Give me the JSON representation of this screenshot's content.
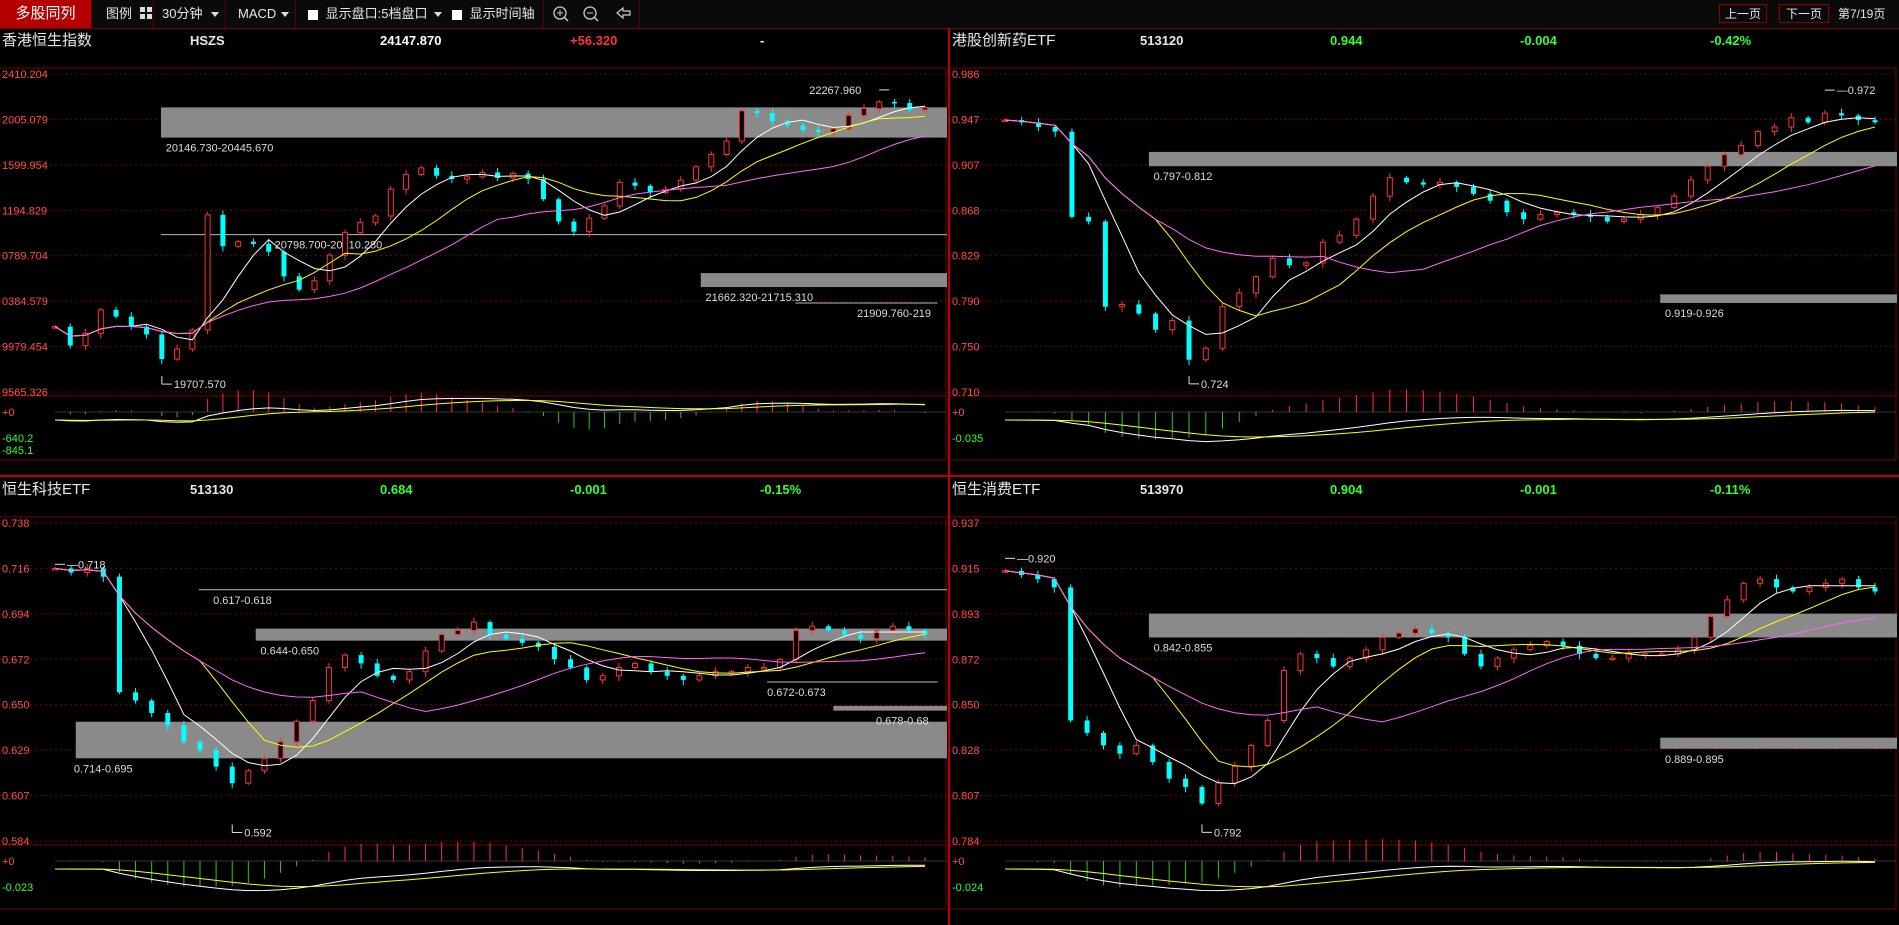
{
  "toolbar": {
    "app_title": "多股同列",
    "legend_label": "图例",
    "legend_icon": "grid-icon",
    "period": "30分钟",
    "indicator": "MACD",
    "option_orderbook": "显示盘口:5档盘口",
    "option_timeaxis": "显示时间轴",
    "prev_page": "上一页",
    "next_page": "下一页",
    "page_indicator": "第7/19页"
  },
  "colors": {
    "up": "#ff3333",
    "down": "#00ffff",
    "ma5": "#ffffff",
    "ma10": "#ffff00",
    "ma20": "#ff66ff",
    "grid": "#7a0000",
    "zone": "#8a8a8a"
  },
  "panels": [
    {
      "name": "香港恒生指数",
      "code": "HSZS",
      "price": "24147.870",
      "change": "+56.320",
      "change_pct": "-",
      "price_color": "#ffffff",
      "change_color": "#ff3333",
      "pct_color": "#ffffff",
      "y_labels": [
        "2410.204",
        "2005.079",
        "1599.954",
        "1194.829",
        "0789.704",
        "0384.579",
        "9979.454",
        "9565.326"
      ],
      "macd_labels": [
        "+0",
        "-640.2",
        "-845.1"
      ],
      "high_label": "22267.960",
      "low_label": "19707.570",
      "zones": [
        "21662.320-21715.310",
        "20798.700-20810.280",
        "20146.730-20445.670",
        "21909.760-219"
      ],
      "chart_data": {
        "type": "candlestick",
        "y_range": [
          19565.326,
          22410.204
        ],
        "close": [
          20150,
          19980,
          20090,
          20300,
          20240,
          20150,
          20080,
          19860,
          19950,
          20120,
          21150,
          20870,
          20910,
          20890,
          20820,
          20600,
          20480,
          20560,
          20790,
          20990,
          21080,
          21140,
          21380,
          21510,
          21570,
          21500,
          21470,
          21490,
          21530,
          21480,
          21520,
          21470,
          21290,
          21090,
          21000,
          21120,
          21230,
          21440,
          21410,
          21350,
          21380,
          21460,
          21580,
          21690,
          21810,
          22080,
          22060,
          21990,
          21950,
          21910,
          21890,
          21920,
          22040,
          22100,
          22160,
          22150,
          22090,
          22110
        ],
        "low_value": 19707.57,
        "high_value": 22267.96
      }
    },
    {
      "name": "港股创新药ETF",
      "code": "513120",
      "price": "0.944",
      "change": "-0.004",
      "change_pct": "-0.42%",
      "price_color": "#33ff33",
      "change_color": "#33ff33",
      "pct_color": "#33ff33",
      "y_labels": [
        "0.986",
        "0.947",
        "0.907",
        "0.868",
        "0.829",
        "0.790",
        "0.750",
        "0.710"
      ],
      "macd_labels": [
        "+0",
        "-0.035"
      ],
      "high_label": "0.972",
      "low_label": "0.724",
      "zones": [
        "0.919-0.926",
        "0.797-0.812"
      ],
      "chart_data": {
        "type": "candlestick",
        "y_range": [
          0.71,
          0.986
        ],
        "close": [
          0.946,
          0.944,
          0.94,
          0.936,
          0.862,
          0.858,
          0.784,
          0.786,
          0.778,
          0.764,
          0.772,
          0.738,
          0.748,
          0.784,
          0.796,
          0.81,
          0.826,
          0.82,
          0.822,
          0.84,
          0.846,
          0.86,
          0.88,
          0.896,
          0.892,
          0.89,
          0.892,
          0.888,
          0.882,
          0.876,
          0.866,
          0.86,
          0.864,
          0.866,
          0.864,
          0.862,
          0.858,
          0.86,
          0.864,
          0.87,
          0.88,
          0.894,
          0.906,
          0.916,
          0.924,
          0.936,
          0.94,
          0.948,
          0.944,
          0.952,
          0.95,
          0.946,
          0.944
        ],
        "low_value": 0.724,
        "high_value": 0.972
      }
    },
    {
      "name": "恒生科技ETF",
      "code": "513130",
      "price": "0.684",
      "change": "-0.001",
      "change_pct": "-0.15%",
      "price_color": "#33ff33",
      "change_color": "#33ff33",
      "pct_color": "#33ff33",
      "y_labels": [
        "0.738",
        "0.716",
        "0.694",
        "0.672",
        "0.650",
        "0.629",
        "0.607",
        "0.584"
      ],
      "macd_labels": [
        "+0",
        "-0.023"
      ],
      "high_label": "0.718",
      "low_label": "0.592",
      "zones": [
        "0.714-0.695",
        "0.672-0.673",
        "0.678-0.68",
        "0.644-0.650",
        "0.617-0.618"
      ],
      "chart_data": {
        "type": "candlestick",
        "y_range": [
          0.584,
          0.738
        ],
        "close": [
          0.716,
          0.714,
          0.716,
          0.712,
          0.656,
          0.652,
          0.646,
          0.64,
          0.632,
          0.628,
          0.62,
          0.612,
          0.618,
          0.624,
          0.632,
          0.642,
          0.652,
          0.668,
          0.674,
          0.67,
          0.664,
          0.662,
          0.666,
          0.676,
          0.684,
          0.686,
          0.69,
          0.684,
          0.682,
          0.68,
          0.678,
          0.672,
          0.668,
          0.662,
          0.664,
          0.668,
          0.67,
          0.666,
          0.664,
          0.662,
          0.664,
          0.666,
          0.666,
          0.668,
          0.668,
          0.672,
          0.686,
          0.688,
          0.686,
          0.684,
          0.682,
          0.686,
          0.688,
          0.686,
          0.684
        ],
        "low_value": 0.592,
        "high_value": 0.718
      }
    },
    {
      "name": "恒生消费ETF",
      "code": "513970",
      "price": "0.904",
      "change": "-0.001",
      "change_pct": "-0.11%",
      "price_color": "#33ff33",
      "change_color": "#33ff33",
      "pct_color": "#33ff33",
      "y_labels": [
        "0.937",
        "0.915",
        "0.893",
        "0.872",
        "0.850",
        "0.828",
        "0.807",
        "0.784"
      ],
      "macd_labels": [
        "+0",
        "-0.024"
      ],
      "high_label": "0.920",
      "low_label": "0.792",
      "zones": [
        "0.889-0.895",
        "0.842-0.855"
      ],
      "chart_data": {
        "type": "candlestick",
        "y_range": [
          0.784,
          0.937
        ],
        "close": [
          0.914,
          0.912,
          0.91,
          0.906,
          0.842,
          0.836,
          0.83,
          0.826,
          0.83,
          0.822,
          0.814,
          0.81,
          0.802,
          0.812,
          0.82,
          0.83,
          0.842,
          0.866,
          0.874,
          0.872,
          0.868,
          0.872,
          0.876,
          0.882,
          0.884,
          0.886,
          0.884,
          0.882,
          0.874,
          0.868,
          0.872,
          0.876,
          0.878,
          0.88,
          0.878,
          0.874,
          0.872,
          0.872,
          0.874,
          0.874,
          0.874,
          0.876,
          0.882,
          0.892,
          0.9,
          0.908,
          0.91,
          0.906,
          0.904,
          0.906,
          0.908,
          0.91,
          0.906,
          0.904
        ],
        "low_value": 0.792,
        "high_value": 0.92
      }
    }
  ]
}
